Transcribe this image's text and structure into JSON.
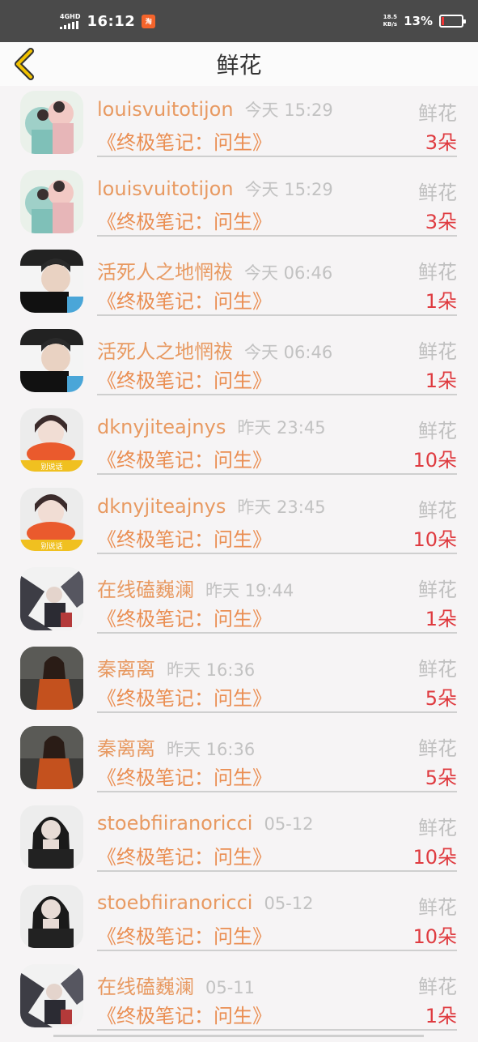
{
  "status": {
    "network": "4GHD",
    "time": "16:12",
    "app_badge": "淘",
    "speed_value": "18.5",
    "speed_unit": "KB/s",
    "battery": "13%"
  },
  "nav": {
    "title": "鲜花",
    "back_icon": "chevron-left-icon"
  },
  "gift_label": "鲜花",
  "book_title": "《终极笔记：问生》",
  "items": [
    {
      "name": "louisvuitotijon",
      "time": "今天 15:29",
      "count": "3朵",
      "avatar": "a"
    },
    {
      "name": "louisvuitotijon",
      "time": "今天 15:29",
      "count": "3朵",
      "avatar": "a"
    },
    {
      "name": "活死人之地惘祓",
      "time": "今天 06:46",
      "count": "1朵",
      "avatar": "b"
    },
    {
      "name": "活死人之地惘祓",
      "time": "今天 06:46",
      "count": "1朵",
      "avatar": "b"
    },
    {
      "name": "dknyjiteajnys",
      "time": "昨天 23:45",
      "count": "10朵",
      "avatar": "c"
    },
    {
      "name": "dknyjiteajnys",
      "time": "昨天 23:45",
      "count": "10朵",
      "avatar": "c"
    },
    {
      "name": "在线磕巍澜",
      "time": "昨天 19:44",
      "count": "1朵",
      "avatar": "d"
    },
    {
      "name": "秦离离",
      "time": "昨天 16:36",
      "count": "5朵",
      "avatar": "e"
    },
    {
      "name": "秦离离",
      "time": "昨天 16:36",
      "count": "5朵",
      "avatar": "e"
    },
    {
      "name": "stoebfiiranoricci",
      "time": "05-12",
      "count": "10朵",
      "avatar": "f"
    },
    {
      "name": "stoebfiiranoricci",
      "time": "05-12",
      "count": "10朵",
      "avatar": "f"
    },
    {
      "name": "在线磕巍澜",
      "time": "05-11",
      "count": "1朵",
      "avatar": "d"
    }
  ],
  "colors": {
    "name": "#e89a62",
    "book": "#ea8e52",
    "count": "#df3b40",
    "muted": "#c0c0c0",
    "back_arrow": "#f2c200"
  }
}
